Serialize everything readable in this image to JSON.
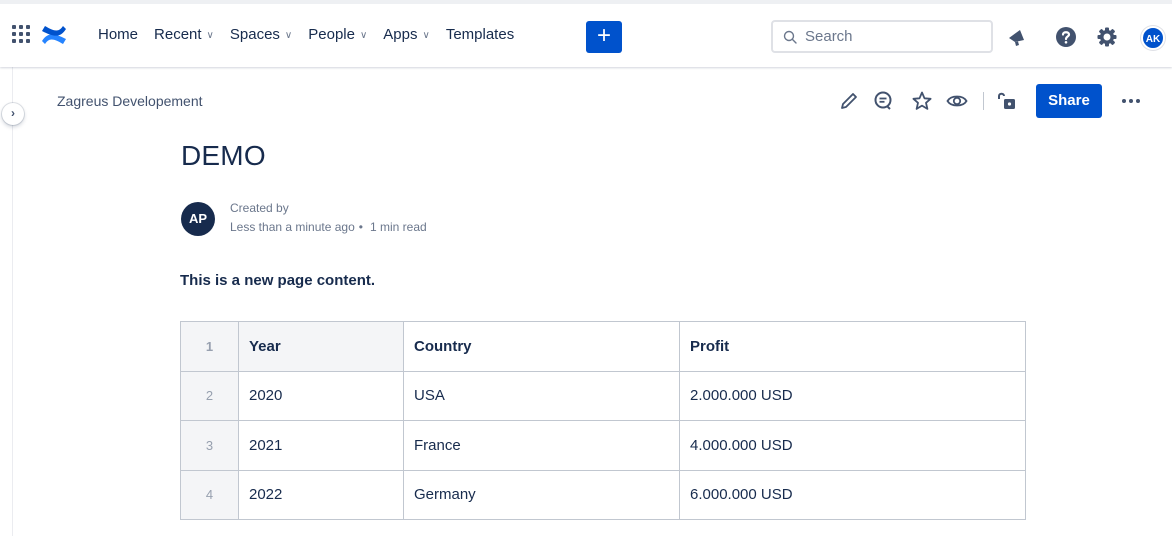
{
  "nav": {
    "items": [
      {
        "label": "Home",
        "dropdown": false
      },
      {
        "label": "Recent",
        "dropdown": true
      },
      {
        "label": "Spaces",
        "dropdown": true
      },
      {
        "label": "People",
        "dropdown": true
      },
      {
        "label": "Apps",
        "dropdown": true
      },
      {
        "label": "Templates",
        "dropdown": false
      }
    ],
    "create_label": "+",
    "search_placeholder": "Search",
    "user_initials": "AK"
  },
  "page": {
    "breadcrumb": "Zagreus Developement",
    "share_label": "Share",
    "title": "DEMO",
    "author_initials": "AP",
    "created_by": "Created by",
    "edited": "Less than a minute ago",
    "separator": "•",
    "read_time": "1 min read",
    "content": "This is a new page content."
  },
  "table": {
    "header": {
      "num": "1",
      "cells": [
        "Year",
        "Country",
        "Profit"
      ]
    },
    "rows": [
      {
        "num": "2",
        "cells": [
          "2020",
          "USA",
          "2.000.000 USD"
        ]
      },
      {
        "num": "3",
        "cells": [
          "2021",
          "France",
          "4.000.000 USD"
        ]
      },
      {
        "num": "4",
        "cells": [
          "2022",
          "Germany",
          "6.000.000 USD"
        ]
      }
    ]
  },
  "colors": {
    "primary": "#0052cc",
    "text": "#172b4d",
    "subtle": "#6b778c",
    "avatar_dark": "#172b4d"
  }
}
